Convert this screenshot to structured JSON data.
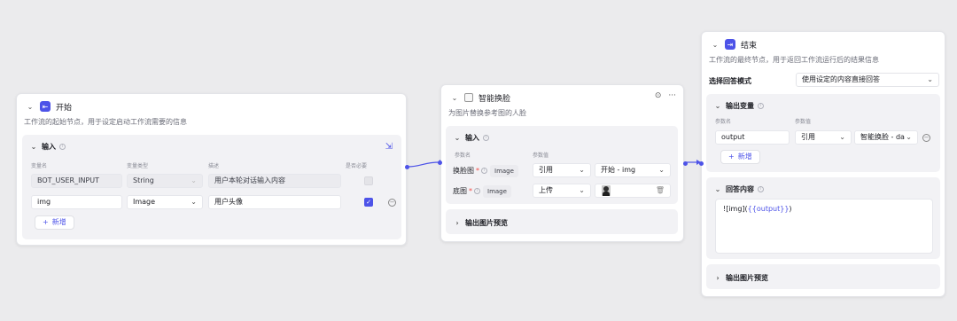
{
  "start_node": {
    "title": "开始",
    "description": "工作流的起始节点，用于设定启动工作流需要的信息",
    "input_section": {
      "title": "输入",
      "headers": [
        "变量名",
        "变量类型",
        "描述",
        "是否必要"
      ],
      "rows": [
        {
          "name": "BOT_USER_INPUT",
          "type": "String",
          "desc": "用户本轮对话输入内容",
          "required": false
        },
        {
          "name": "img",
          "type": "Image",
          "desc": "用户头像",
          "required": true
        }
      ],
      "add_label": "新增"
    }
  },
  "face_swap_node": {
    "title": "智能换脸",
    "description": "为图片替换参考图的人脸",
    "input_section": {
      "title": "输入",
      "headers": [
        "参数名",
        "参数值"
      ],
      "rows": [
        {
          "name": "换脸图",
          "type": "Image",
          "source": "引用",
          "value": "开始 - img"
        },
        {
          "name": "底图",
          "type": "Image",
          "source": "上传",
          "value": ""
        }
      ]
    },
    "output_preview": "输出图片预览"
  },
  "end_node": {
    "title": "结束",
    "description": "工作流的最终节点，用于返回工作流运行后的结果信息",
    "answer_mode_label": "选择回答模式",
    "answer_mode_value": "使用设定的内容直接回答",
    "output_section": {
      "title": "输出变量",
      "headers": [
        "参数名",
        "参数值"
      ],
      "rows": [
        {
          "name": "output",
          "source": "引用",
          "value": "智能换脸 - da"
        }
      ],
      "add_label": "新增"
    },
    "answer_section": {
      "title": "回答内容",
      "content_prefix": "![img](",
      "content_ref": "{{output}}",
      "content_suffix": ")"
    },
    "output_preview": "输出图片预览"
  },
  "colors": {
    "accent": "#4d53e8",
    "canvas": "#ebebed",
    "panel": "#f2f2f5",
    "required": "#f54a45"
  },
  "icons": {
    "start": "start-node-icon",
    "face_swap": "image-node-icon",
    "end": "end-node-icon"
  }
}
